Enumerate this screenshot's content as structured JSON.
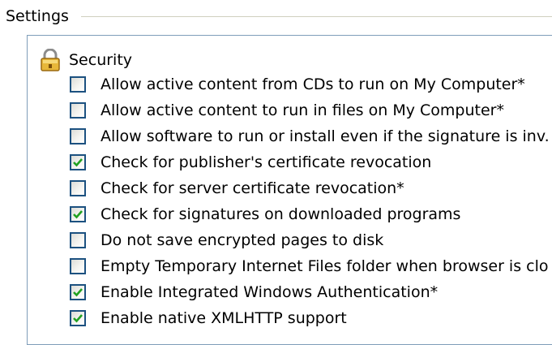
{
  "group": {
    "title": "Settings"
  },
  "section": {
    "title": "Security",
    "icon": "lock-icon"
  },
  "colors": {
    "check": "#21a121",
    "checkbox_border": "#1c5180",
    "list_border": "#7f9db9"
  },
  "items": [
    {
      "label": "Allow active content from CDs to run on My Computer*",
      "checked": false
    },
    {
      "label": "Allow active content to run in files on My Computer*",
      "checked": false
    },
    {
      "label": "Allow software to run or install even if the signature is inv.",
      "checked": false
    },
    {
      "label": "Check for publisher's certificate revocation",
      "checked": true
    },
    {
      "label": "Check for server certificate revocation*",
      "checked": false
    },
    {
      "label": "Check for signatures on downloaded programs",
      "checked": true
    },
    {
      "label": "Do not save encrypted pages to disk",
      "checked": false
    },
    {
      "label": "Empty Temporary Internet Files folder when browser is clo",
      "checked": false
    },
    {
      "label": "Enable Integrated Windows Authentication*",
      "checked": true
    },
    {
      "label": "Enable native XMLHTTP support",
      "checked": true
    }
  ]
}
